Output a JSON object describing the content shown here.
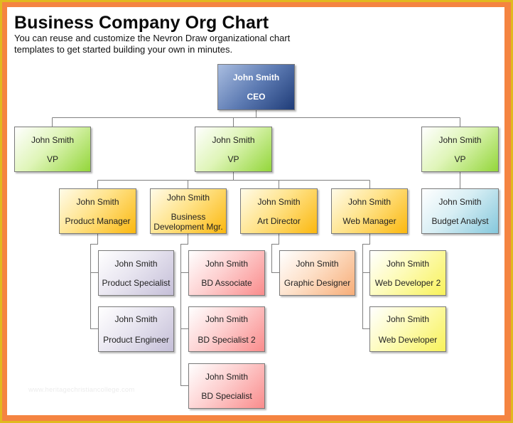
{
  "header": {
    "title": "Business Company Org Chart",
    "subtitle": "You can reuse and customize the Nevron Draw organizational chart templates to get started building your own in minutes."
  },
  "watermark": "www.heritagechristiancollege.com",
  "colors": {
    "frame_outer": "#e1b91f",
    "frame_inner": "#f58441",
    "connector": "#808080"
  },
  "org": {
    "ceo": {
      "name": "John Smith",
      "title": "CEO"
    },
    "vp_left": {
      "name": "John Smith",
      "title": "VP"
    },
    "vp_middle": {
      "name": "John Smith",
      "title": "VP"
    },
    "vp_right": {
      "name": "John Smith",
      "title": "VP"
    },
    "product_manager": {
      "name": "John Smith",
      "title": "Product Manager"
    },
    "bd_manager": {
      "name": "John Smith",
      "title": "Business Development Mgr."
    },
    "art_director": {
      "name": "John Smith",
      "title": "Art Director"
    },
    "web_manager": {
      "name": "John Smith",
      "title": "Web Manager"
    },
    "budget_analyst": {
      "name": "John Smith",
      "title": "Budget Analyst"
    },
    "product_specialist": {
      "name": "John Smith",
      "title": "Product Specialist"
    },
    "product_engineer": {
      "name": "John Smith",
      "title": "Product Engineer"
    },
    "bd_associate": {
      "name": "John Smith",
      "title": "BD Associate"
    },
    "bd_specialist_2": {
      "name": "John Smith",
      "title": "BD Specialist 2"
    },
    "bd_specialist": {
      "name": "John Smith",
      "title": "BD Specialist"
    },
    "graphic_designer": {
      "name": "John Smith",
      "title": "Graphic Designer"
    },
    "web_developer_2": {
      "name": "John Smith",
      "title": "Web Developer 2"
    },
    "web_developer": {
      "name": "John Smith",
      "title": "Web Developer"
    }
  }
}
